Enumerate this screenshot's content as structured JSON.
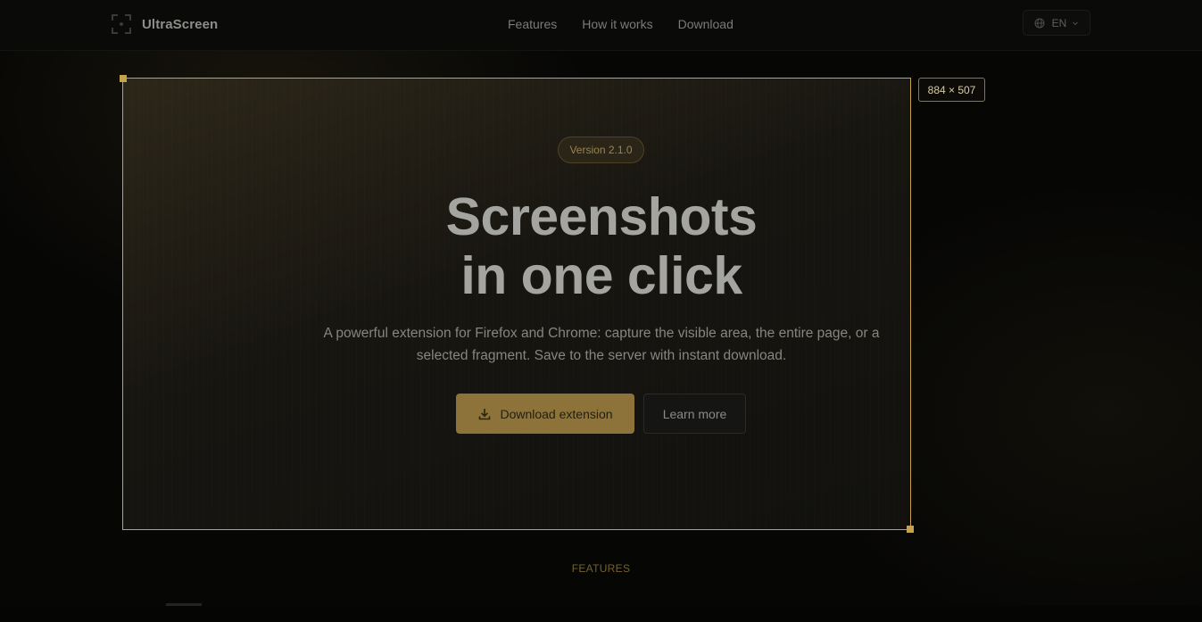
{
  "app": {
    "name": "UltraScreen"
  },
  "nav": {
    "items": [
      "Features",
      "How it works",
      "Download"
    ]
  },
  "language": {
    "current": "EN"
  },
  "selection": {
    "size_label": "884 × 507"
  },
  "hero": {
    "version_badge": "Version 2.1.0",
    "title_line1": "Screenshots",
    "title_line2": "in one click",
    "subtitle": "A powerful extension for Firefox and Chrome: capture the visible area, the entire page, or a selected fragment. Save to the server with instant download.",
    "primary_button": "Download extension",
    "secondary_button": "Learn more"
  },
  "features": {
    "section_label": "FEATURES"
  },
  "colors": {
    "accent": "#c6a24e",
    "primary_button": "#8d7339"
  },
  "icons": {
    "logo": "capture-frame-icon",
    "language": "globe-icon",
    "dropdown": "chevron-down-icon",
    "download": "download-icon"
  }
}
